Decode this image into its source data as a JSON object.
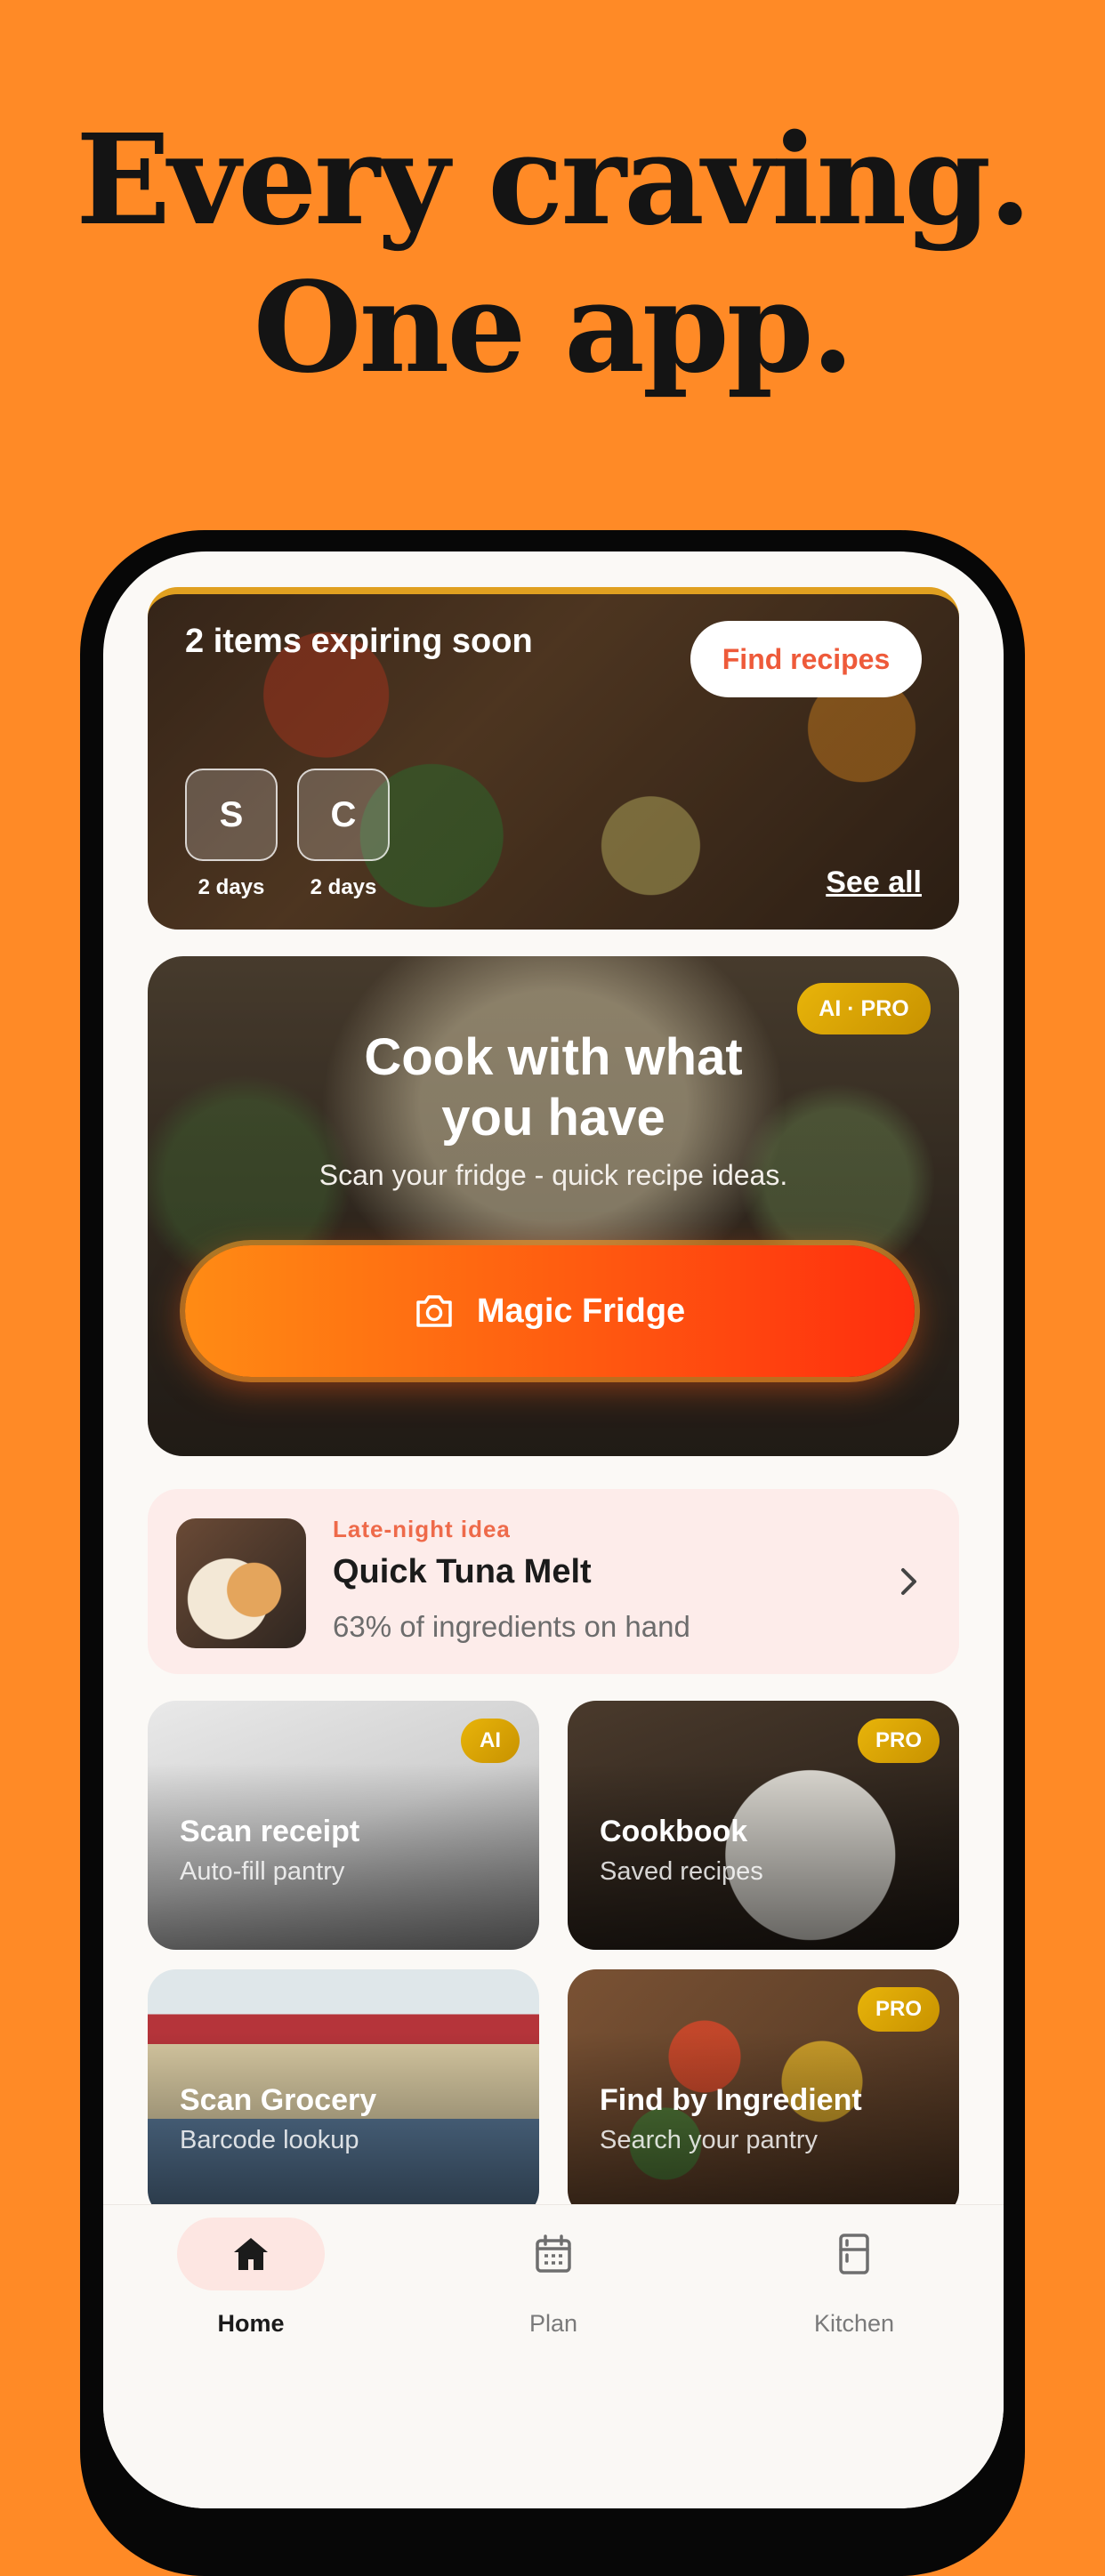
{
  "headline": {
    "line1": "Every craving.",
    "line2": "One app."
  },
  "expiring": {
    "title": "2 items expiring soon",
    "find_button": "Find recipes",
    "items": [
      {
        "letter": "S",
        "days": "2 days"
      },
      {
        "letter": "C",
        "days": "2 days"
      }
    ],
    "see_all": "See all"
  },
  "magic_fridge": {
    "badge": "AI · PRO",
    "title_line1": "Cook with what",
    "title_line2": "you have",
    "subtitle": "Scan your fridge - quick recipe ideas.",
    "button": "Magic Fridge"
  },
  "late_night": {
    "tag": "Late-night idea",
    "title": "Quick Tuna Melt",
    "subtitle": "63% of ingredients on hand"
  },
  "tiles": [
    {
      "title": "Scan receipt",
      "subtitle": "Auto-fill pantry",
      "badge": "AI"
    },
    {
      "title": "Cookbook",
      "subtitle": "Saved recipes",
      "badge": "PRO"
    },
    {
      "title": "Scan Grocery",
      "subtitle": "Barcode lookup",
      "badge": ""
    },
    {
      "title": "Find by Ingredient",
      "subtitle": "Search your pantry",
      "badge": "PRO"
    }
  ],
  "tabs": [
    {
      "label": "Home",
      "icon": "home-icon",
      "active": true
    },
    {
      "label": "Plan",
      "icon": "calendar-icon",
      "active": false
    },
    {
      "label": "Kitchen",
      "icon": "fridge-icon",
      "active": false
    }
  ],
  "colors": {
    "background": "#FF8A26",
    "accent": "#EE5A3A",
    "badge_gold": "#E8B40A",
    "late_bg": "#FDECEA"
  }
}
